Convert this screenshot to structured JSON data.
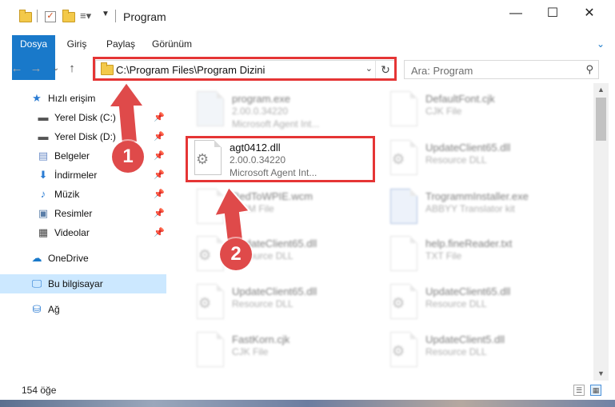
{
  "window": {
    "title": "Program",
    "minimize": "—",
    "maximize": "☐",
    "close": "✕"
  },
  "ribbon": {
    "tabs": [
      {
        "label": "Dosya"
      },
      {
        "label": "Giriş"
      },
      {
        "label": "Paylaş"
      },
      {
        "label": "Görünüm"
      }
    ]
  },
  "navigation": {
    "address": "C:\\Program Files\\Program Dizini",
    "search_placeholder": "Ara: Program"
  },
  "sidebar": {
    "items": [
      {
        "label": "Hızlı erişim",
        "icon": "star-icon"
      },
      {
        "label": "Yerel Disk (C:)",
        "icon": "drive-icon"
      },
      {
        "label": "Yerel Disk (D:)",
        "icon": "drive-icon"
      },
      {
        "label": "Belgeler",
        "icon": "documents-icon"
      },
      {
        "label": "İndirmeler",
        "icon": "download-icon"
      },
      {
        "label": "Müzik",
        "icon": "music-icon"
      },
      {
        "label": "Resimler",
        "icon": "pictures-icon"
      },
      {
        "label": "Videolar",
        "icon": "video-icon"
      },
      {
        "label": "OneDrive",
        "icon": "cloud-icon"
      },
      {
        "label": "Bu bilgisayar",
        "icon": "computer-icon"
      },
      {
        "label": "Ağ",
        "icon": "network-icon"
      }
    ]
  },
  "files": [
    {
      "name": "program.exe",
      "line1": "2.00.0.34220",
      "line2": "Microsoft Agent Int..."
    },
    {
      "name": "DefaultFont.cjk",
      "line1": "CJK File",
      "line2": ""
    },
    {
      "name": "agt0412.dll",
      "line1": "2.00.0.34220",
      "line2": "Microsoft Agent Int..."
    },
    {
      "name": "UpdateClient65.dll",
      "line1": "Resource DLL",
      "line2": ""
    },
    {
      "name": "RedToWPIE.wcm",
      "line1": "WCM File",
      "line2": ""
    },
    {
      "name": "TrogrammInstaller.exe",
      "line1": "ABBYY Translator kit",
      "line2": ""
    },
    {
      "name": "UpdateClient65.dll",
      "line1": "Resource DLL",
      "line2": ""
    },
    {
      "name": "help.fineReader.txt",
      "line1": "TXT File",
      "line2": ""
    },
    {
      "name": "UpdateClient65.dll",
      "line1": "Resource DLL",
      "line2": ""
    },
    {
      "name": "UpdateClient65.dll",
      "line1": "Resource DLL",
      "line2": ""
    },
    {
      "name": "FastKorn.cjk",
      "line1": "CJK File",
      "line2": ""
    },
    {
      "name": "UpdateClient5.dll",
      "line1": "Resource DLL",
      "line2": ""
    }
  ],
  "status": {
    "count": "154 öğe"
  },
  "markers": {
    "one": "1",
    "two": "2"
  },
  "colors": {
    "accent": "#1979ca",
    "highlight": "#e53535",
    "marker": "#df4a4a",
    "selected": "#cce8ff"
  }
}
